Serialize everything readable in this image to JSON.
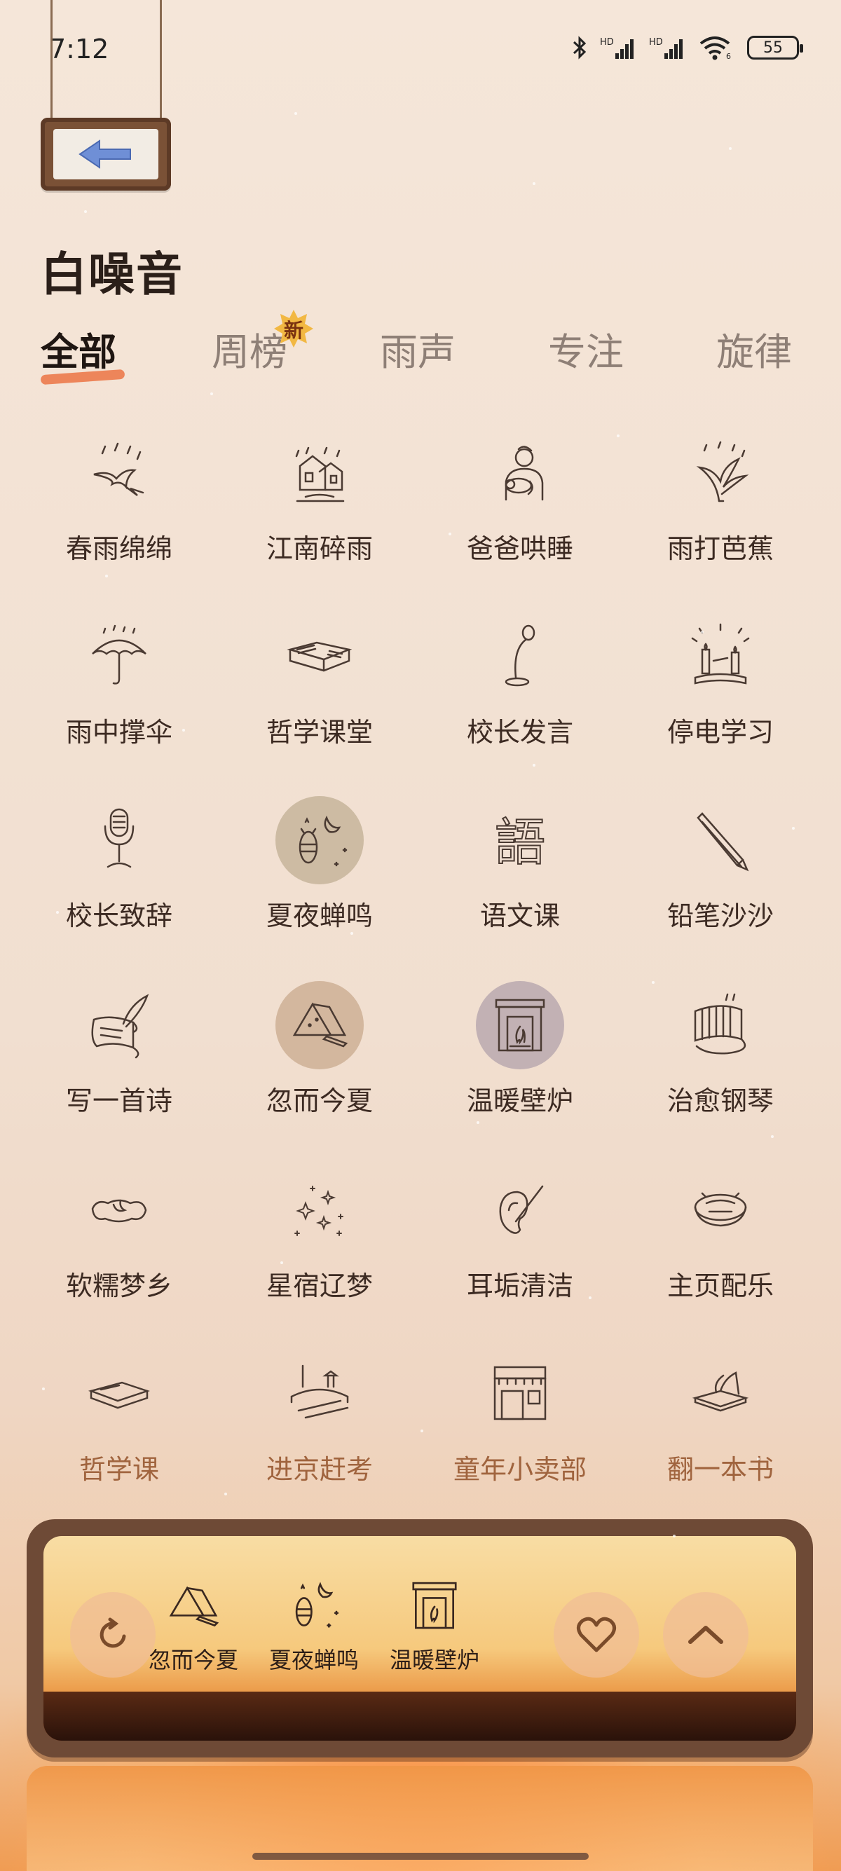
{
  "status_bar": {
    "time": "7:12",
    "battery": "55",
    "icons": [
      "bluetooth-icon",
      "signal-icon",
      "signal-icon",
      "wifi-icon",
      "battery-icon"
    ]
  },
  "page": {
    "title": "白噪音"
  },
  "tabs": [
    {
      "label": "全部",
      "active": true
    },
    {
      "label": "周榜",
      "badge": "新"
    },
    {
      "label": "雨声"
    },
    {
      "label": "专注"
    },
    {
      "label": "旋律"
    }
  ],
  "sounds": [
    {
      "label": "春雨绵绵",
      "icon": "swallow-rain-icon"
    },
    {
      "label": "江南碎雨",
      "icon": "jiangnan-house-icon"
    },
    {
      "label": "爸爸哄睡",
      "icon": "father-baby-icon"
    },
    {
      "label": "雨打芭蕉",
      "icon": "banana-leaf-icon"
    },
    {
      "label": "雨中撑伞",
      "icon": "umbrella-icon"
    },
    {
      "label": "哲学课堂",
      "icon": "open-book-icon"
    },
    {
      "label": "校长发言",
      "icon": "microphone-stand-icon"
    },
    {
      "label": "停电学习",
      "icon": "candles-icon"
    },
    {
      "label": "校长致辞",
      "icon": "retro-microphone-icon"
    },
    {
      "label": "夏夜蝉鸣",
      "icon": "cicada-moon-icon",
      "selected": true
    },
    {
      "label": "语文课",
      "icon": "chinese-character-icon"
    },
    {
      "label": "铅笔沙沙",
      "icon": "pencil-icon"
    },
    {
      "label": "写一首诗",
      "icon": "quill-scroll-icon"
    },
    {
      "label": "忽而今夏",
      "icon": "paper-tent-icon",
      "selected": true
    },
    {
      "label": "温暖壁炉",
      "icon": "fireplace-icon",
      "selected": true
    },
    {
      "label": "治愈钢琴",
      "icon": "piano-icon"
    },
    {
      "label": "软糯梦乡",
      "icon": "moon-pillow-icon"
    },
    {
      "label": "星宿辽梦",
      "icon": "stars-icon"
    },
    {
      "label": "耳垢清洁",
      "icon": "ear-pick-icon"
    },
    {
      "label": "主页配乐",
      "icon": "record-bowl-icon"
    },
    {
      "label": "哲学课",
      "icon": "closed-book-icon"
    },
    {
      "label": "进京赶考",
      "icon": "bridge-pavilion-icon"
    },
    {
      "label": "童年小卖部",
      "icon": "shop-icon"
    },
    {
      "label": "翻一本书",
      "icon": "flipping-book-icon"
    }
  ],
  "mixer": {
    "items": [
      {
        "label": "忽而今夏",
        "icon": "paper-tent-icon"
      },
      {
        "label": "夏夜蝉鸣",
        "icon": "cicada-moon-icon"
      },
      {
        "label": "温暖壁炉",
        "icon": "fireplace-icon"
      }
    ],
    "buttons": [
      "replay-icon",
      "heart-icon",
      "chevron-up-icon"
    ]
  }
}
